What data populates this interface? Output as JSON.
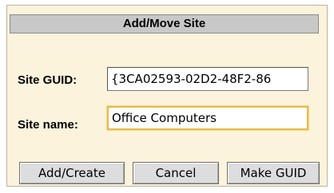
{
  "dialog": {
    "title": "Add/Move Site"
  },
  "form": {
    "guid_label": "Site GUID:",
    "guid_value": "{3CA02593-02D2-48F2-86",
    "name_label": "Site name:",
    "name_value": "Office Computers"
  },
  "buttons": {
    "add_create": "Add/Create",
    "cancel": "Cancel",
    "make_guid": "Make GUID"
  },
  "colors": {
    "panel_bg": "#fcf3dc",
    "titlebar_bg": "#c8c8c8",
    "focus_border": "#e9b94a",
    "button_bg": "#dddddd"
  }
}
